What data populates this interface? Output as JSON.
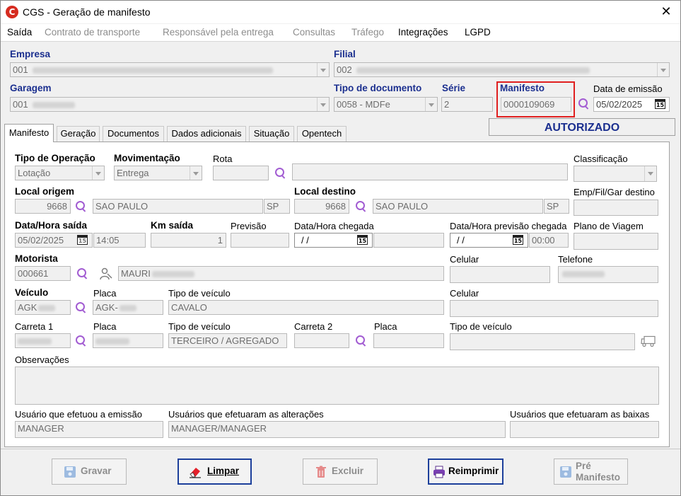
{
  "window": {
    "title": "CGS - Geração de manifesto",
    "close": "✕"
  },
  "menu": [
    "Saída",
    "Contrato de transporte",
    "Responsável pela entrega",
    "Consultas",
    "Tráfego",
    "Integrações",
    "LGPD"
  ],
  "header": {
    "empresa_label": "Empresa",
    "empresa_value": "001",
    "filial_label": "Filial",
    "filial_value": "002",
    "garagem_label": "Garagem",
    "garagem_value": "001",
    "tipo_doc_label": "Tipo de documento",
    "tipo_doc_value": "0058 - MDFe",
    "serie_label": "Série",
    "serie_value": "2",
    "manifesto_label": "Manifesto",
    "manifesto_value": "0000109069",
    "data_emissao_label": "Data de emissão",
    "data_emissao_value": "05/02/2025",
    "status": "AUTORIZADO"
  },
  "tabs": [
    "Manifesto",
    "Geração",
    "Documentos",
    "Dados adicionais",
    "Situação",
    "Opentech"
  ],
  "form": {
    "tipo_operacao_label": "Tipo de Operação",
    "tipo_operacao_value": "Lotação",
    "movimentacao_label": "Movimentação",
    "movimentacao_value": "Entrega",
    "rota_label": "Rota",
    "classificacao_label": "Classificação",
    "local_origem_label": "Local origem",
    "local_origem_code": "9668",
    "local_origem_city": "SAO PAULO",
    "local_origem_uf": "SP",
    "local_destino_label": "Local destino",
    "local_destino_code": "9668",
    "local_destino_city": "SAO PAULO",
    "local_destino_uf": "SP",
    "emp_fil_gar_label": "Emp/Fil/Gar destino",
    "data_saida_label": "Data/Hora saída",
    "data_saida_value": "05/02/2025",
    "hora_saida_value": "14:05",
    "km_saida_label": "Km saída",
    "km_saida_value": "1",
    "previsao_label": "Previsão",
    "data_chegada_label": "Data/Hora chegada",
    "data_chegada_value": "/ /",
    "data_prev_chegada_label": "Data/Hora previsão chegada",
    "data_prev_chegada_value": "/ /",
    "hora_prev_chegada_value": "00:00",
    "plano_viagem_label": "Plano de Viagem",
    "motorista_label": "Motorista",
    "motorista_code": "000661",
    "motorista_name": "MAURI",
    "celular_label": "Celular",
    "telefone_label": "Telefone",
    "veiculo_label": "Veículo",
    "veiculo_value": "AGK",
    "placa_label": "Placa",
    "placa_value": "AGK-",
    "tipo_veiculo_label": "Tipo de veículo",
    "tipo_veiculo_value": "CAVALO",
    "celular2_label": "Celular",
    "carreta1_label": "Carreta 1",
    "placa2_label": "Placa",
    "tipo_veiculo2_label": "Tipo de veículo",
    "tipo_veiculo2_value": "TERCEIRO / AGREGADO",
    "carreta2_label": "Carreta 2",
    "placa3_label": "Placa",
    "tipo_veiculo3_label": "Tipo de veículo",
    "observacoes_label": "Observações",
    "usuario_emissao_label": "Usuário que efetuou a emissão",
    "usuario_emissao_value": "MANAGER",
    "usuarios_alteracoes_label": "Usuários que efetuaram as alterações",
    "usuarios_alteracoes_value": "MANAGER/MANAGER",
    "usuarios_baixas_label": "Usuários que efetuaram as baixas"
  },
  "buttons": {
    "gravar": "Gravar",
    "limpar": "Limpar",
    "excluir": "Excluir",
    "reimprimir": "Reimprimir",
    "pre_manifesto_1": "Pré",
    "pre_manifesto_2": "Manifesto"
  },
  "icons": {
    "app": "cgs-logo-icon",
    "lookup": "search-icon",
    "calendar": "calendar-icon",
    "driver": "driver-icon",
    "vehicle": "truck-icon"
  },
  "colors": {
    "accent_blue": "#1b2f8f",
    "highlight_red": "#e01f1f",
    "lookup_purple": "#a25cd2"
  }
}
